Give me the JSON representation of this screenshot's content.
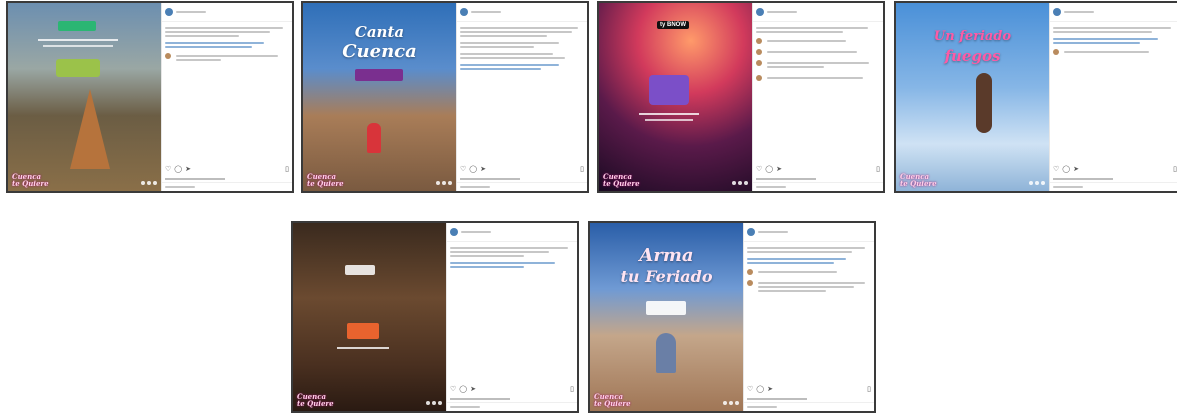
{
  "cards": [
    {
      "title_line1": "",
      "title_line2": "",
      "badge": ""
    },
    {
      "title_line1": "Canta",
      "title_line2": "Cuenca",
      "badge": ""
    },
    {
      "title_line1": "",
      "title_line2": "",
      "badge": "ty BNOW"
    },
    {
      "title_line1": "Un feriado",
      "title_line2": "fuegos",
      "badge": ""
    },
    {
      "title_line1": "",
      "title_line2": "",
      "badge": ""
    },
    {
      "title_line1": "Arma",
      "title_line2": "tu Feriado",
      "badge": ""
    }
  ],
  "icons": {
    "like": "heart-icon",
    "comment": "comment-icon",
    "share": "share-icon",
    "save": "bookmark-icon"
  }
}
